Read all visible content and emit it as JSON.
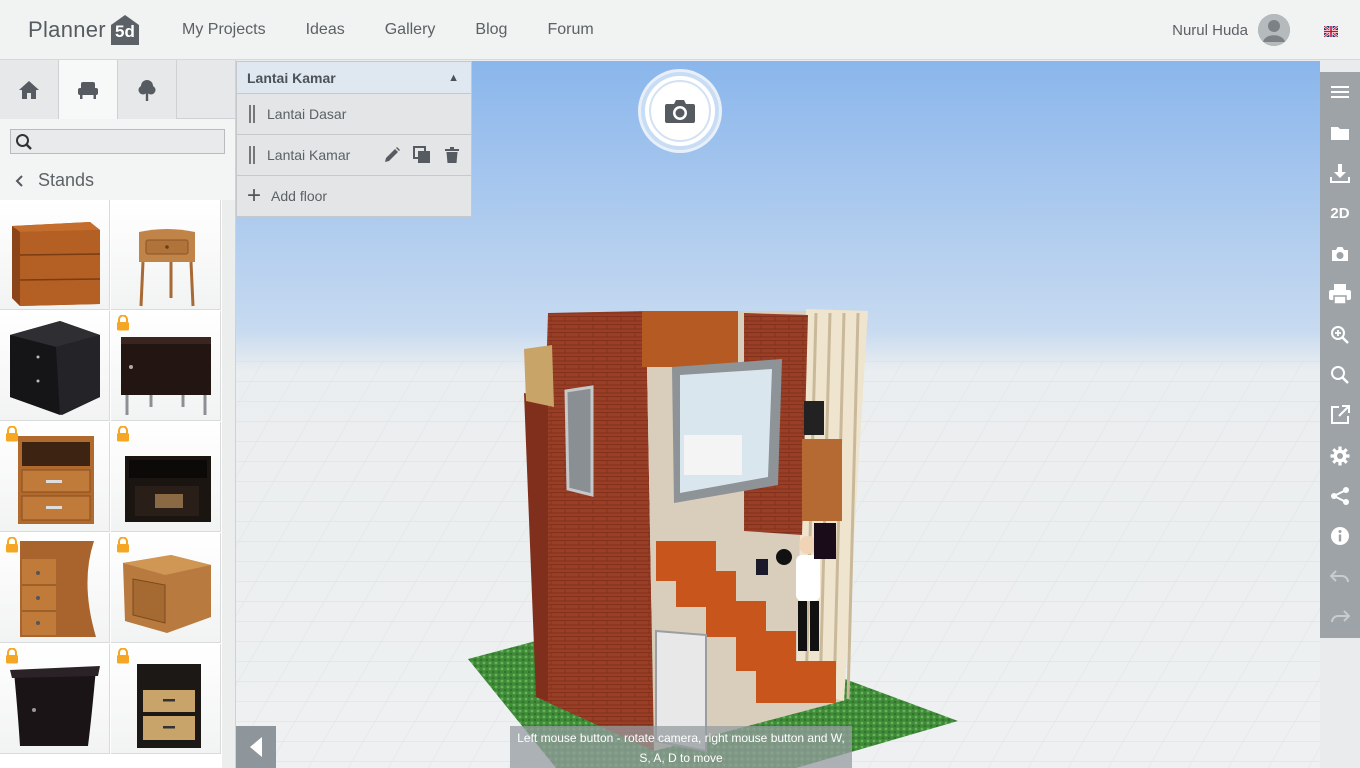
{
  "app": {
    "logo_text": "Planner",
    "logo_badge": "5d"
  },
  "nav": {
    "items": [
      "My Projects",
      "Ideas",
      "Gallery",
      "Blog",
      "Forum"
    ]
  },
  "user": {
    "name": "Nurul Huda"
  },
  "sidebar": {
    "search_placeholder": "",
    "breadcrumb": "Stands",
    "tabs": [
      "home-icon",
      "furniture-icon",
      "tree-icon"
    ]
  },
  "floors": {
    "current": "Lantai Kamar",
    "list": [
      {
        "label": "Lantai Dasar"
      },
      {
        "label": "Lantai Kamar"
      }
    ],
    "add_label": "Add floor"
  },
  "viewport": {
    "hint": "Left mouse button - rotate camera, right mouse button and W, S, A, D to move"
  },
  "right_toolbar": {
    "view_mode_label": "2D"
  },
  "colors": {
    "topbar": "#f1f2f2",
    "toolbar": "#9ea3a7",
    "accent_lock": "#f5a623",
    "sky": "#8ab6ec"
  }
}
